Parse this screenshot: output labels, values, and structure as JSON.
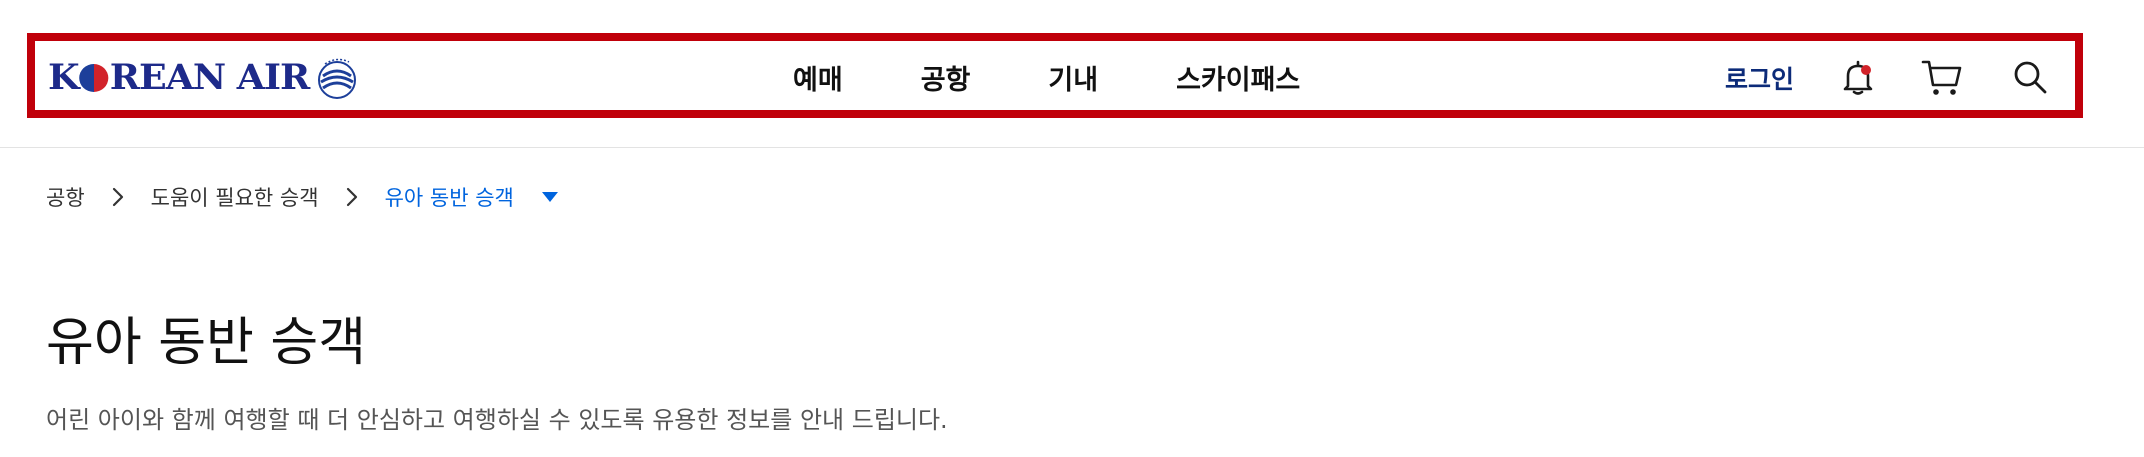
{
  "header": {
    "logo_text_pre": "K",
    "logo_text_post": "REAN AIR",
    "nav": [
      {
        "label": "예매"
      },
      {
        "label": "공항"
      },
      {
        "label": "기내"
      },
      {
        "label": "스카이패스"
      }
    ],
    "login_label": "로그인",
    "icons": {
      "notification": "bell-icon",
      "notification_dot_color": "#d2232a",
      "cart": "cart-icon",
      "search": "search-icon"
    },
    "highlight_color": "#c0000a",
    "brand_color": "#1d2a8a"
  },
  "breadcrumb": {
    "items": [
      {
        "label": "공항"
      },
      {
        "label": "도움이 필요한 승객"
      }
    ],
    "current": "유아 동반 승객",
    "current_color": "#0064de"
  },
  "main": {
    "title": "유아 동반 승객",
    "description": "어린 아이와 함께 여행할 때 더 안심하고 여행하실 수 있도록 유용한 정보를 안내 드립니다."
  }
}
